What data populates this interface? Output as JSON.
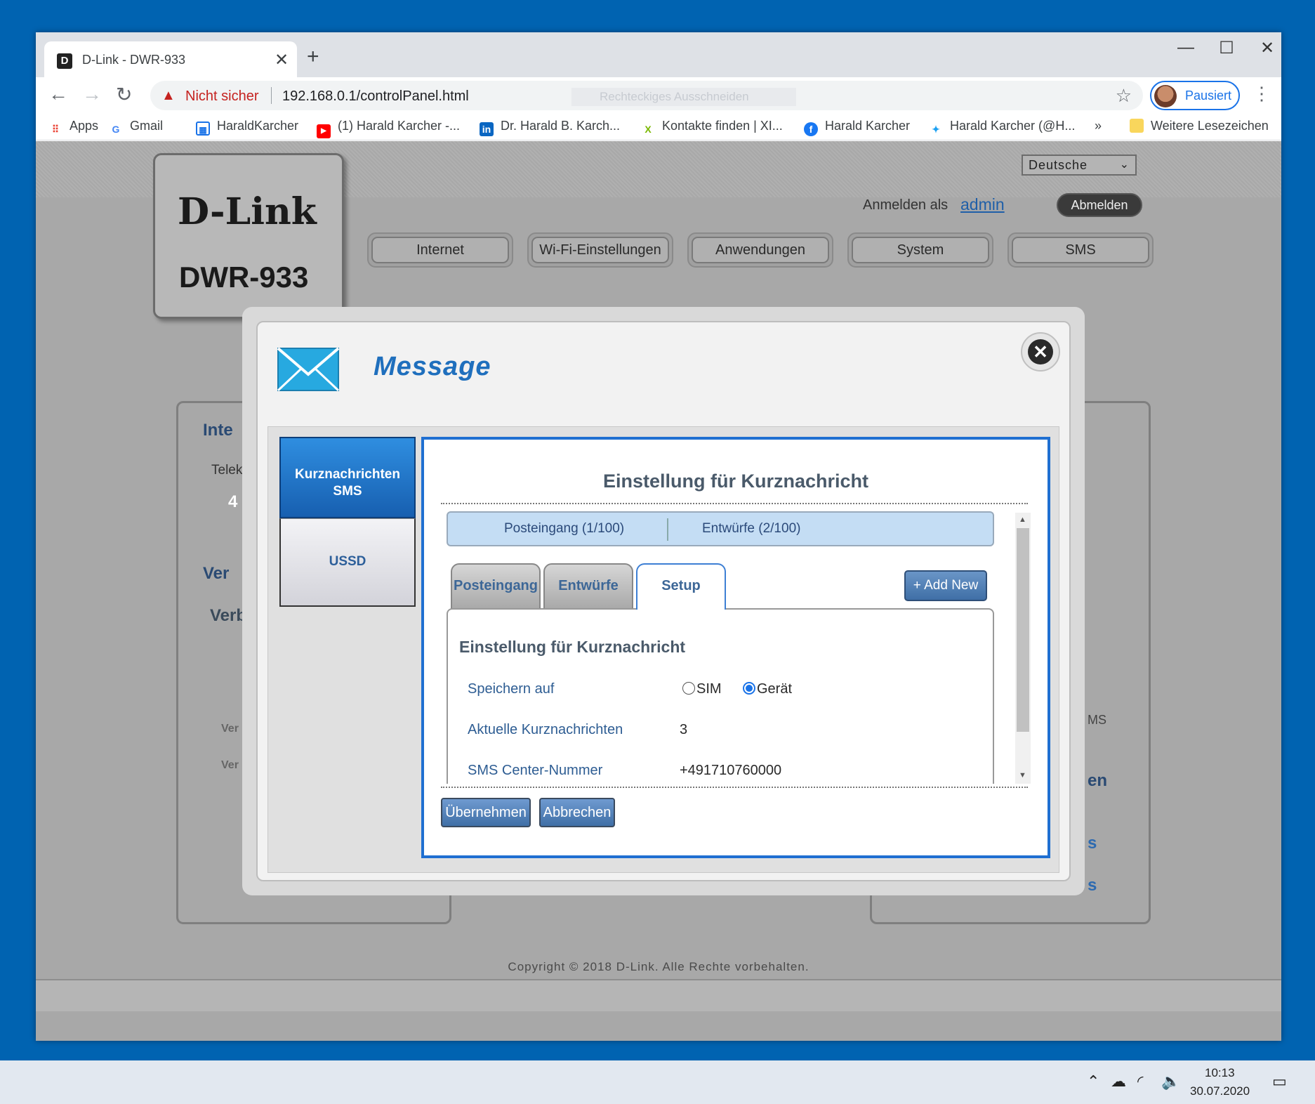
{
  "browser": {
    "tab_title": "D-Link - DWR-933",
    "tab_favicon": "D",
    "close_tab": "✕",
    "new_tab": "+",
    "window_controls": {
      "minimize": "—",
      "maximize": "☐",
      "close": "✕"
    },
    "security_label": "Nicht sicher",
    "url": "192.168.0.1/controlPanel.html",
    "omnibox_ghost": "Rechteckiges Ausschneiden",
    "profile_label": "Pausiert",
    "bookmarks": [
      {
        "label": "Apps",
        "icon": "apps-grid-icon",
        "glyph": "⋮⋮",
        "color": "#ea4335"
      },
      {
        "label": "Gmail",
        "icon": "google-icon",
        "glyph": "G",
        "color": "#4285f4"
      },
      {
        "label": "HaraldKarcher",
        "icon": "page-icon",
        "glyph": "▦",
        "color": "#1a73e8"
      },
      {
        "label": "(1) Harald Karcher -...",
        "icon": "youtube-icon",
        "glyph": "▶",
        "color": "#ff0000"
      },
      {
        "label": "Dr. Harald B. Karch...",
        "icon": "linkedin-icon",
        "glyph": "in",
        "color": "#0a66c2"
      },
      {
        "label": "Kontakte finden | XI...",
        "icon": "xing-icon",
        "glyph": "X",
        "color": "#7ab800"
      },
      {
        "label": "Harald Karcher",
        "icon": "facebook-icon",
        "glyph": "f",
        "color": "#1877f2"
      },
      {
        "label": "Harald Karcher (@H...",
        "icon": "twitter-icon",
        "glyph": "✦",
        "color": "#1da1f2"
      }
    ],
    "bookmarks_overflow": "»",
    "other_bookmarks": "Weitere Lesezeichen"
  },
  "router": {
    "brand": "D-Link",
    "model": "DWR-933",
    "language": "Deutsche",
    "login_label": "Anmelden als",
    "login_user": "admin",
    "logout": "Abmelden",
    "nav": [
      "Internet",
      "Wi-Fi-Einstellungen",
      "Anwendungen",
      "System",
      "SMS"
    ],
    "bg_fragments": [
      "Inte",
      "Telek",
      "4",
      "Ver",
      "Verb",
      "Ver",
      "Ver",
      "MS",
      "en",
      "s",
      "s"
    ],
    "copyright": "Copyright © 2018 D-Link. Alle Rechte vorbehalten."
  },
  "modal": {
    "title": "Message",
    "close": "✕",
    "side_tabs": {
      "sms_line1": "Kurznachrichten",
      "sms_line2": "SMS",
      "ussd": "USSD"
    },
    "content_title": "Einstellung für Kurznachricht",
    "counters": {
      "inbox": "Posteingang (1/100)",
      "drafts": "Entwürfe (2/100)"
    },
    "subtabs": [
      "Posteingang",
      "Entwürfe",
      "Setup"
    ],
    "add_new": "+ Add New",
    "form": {
      "title": "Einstellung für Kurznachricht",
      "store_label": "Speichern auf",
      "store_options": [
        "SIM",
        "Gerät"
      ],
      "store_selected": "Gerät",
      "current_label": "Aktuelle Kurznachrichten",
      "current_value": "3",
      "center_label": "SMS Center-Nummer",
      "center_value": "+491710760000"
    },
    "apply": "Übernehmen",
    "cancel": "Abbrechen"
  },
  "taskbar": {
    "time": "10:13",
    "date": "30.07.2020",
    "tray_icons": [
      "chevron-up-icon",
      "cloud-icon",
      "wifi-icon",
      "volume-icon",
      "notification-icon"
    ]
  }
}
